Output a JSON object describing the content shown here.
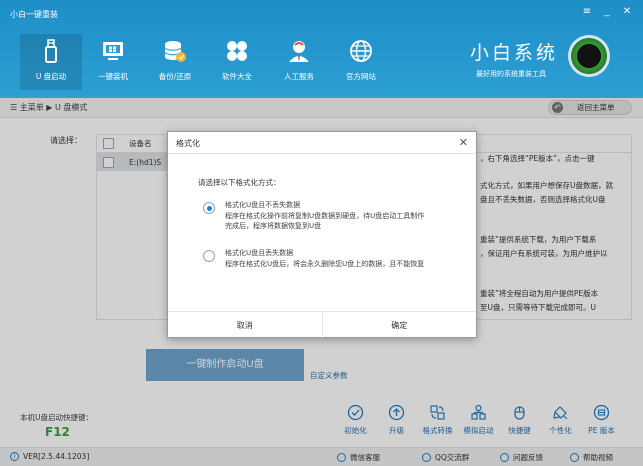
{
  "app": {
    "title": "小白一键重装",
    "window_controls": [
      "≡",
      "_",
      "✕"
    ],
    "brand_name": "小白系统",
    "brand_slogan": "最好用的系统重装工具"
  },
  "nav": {
    "items": [
      {
        "label": "U 盘启动",
        "icon": "usb-drive-icon",
        "active": true
      },
      {
        "label": "一键装机",
        "icon": "monitor-icon",
        "active": false
      },
      {
        "label": "备份/还原",
        "icon": "database-icon",
        "active": false
      },
      {
        "label": "软件大全",
        "icon": "apps-icon",
        "active": false
      },
      {
        "label": "人工服务",
        "icon": "person-service-icon",
        "active": false
      },
      {
        "label": "官方网站",
        "icon": "globe-icon",
        "active": false
      }
    ]
  },
  "breadcrumb": {
    "text": "☰ 主菜单 ▶ U 盘模式",
    "back_label": "返回主菜单"
  },
  "main": {
    "select_label": "请选择：",
    "table": {
      "headers": [
        "设备名"
      ],
      "rows": [
        [
          "E:(hd1)S"
        ]
      ]
    },
    "info_lines": [
      "，右下角选择“PE版本”，点击一键",
      "",
      "式化方式，如果用户想保存U盘数据，就",
      "盘且不丢失数据，否则选择格式化U盘",
      "",
      "",
      "重装”提供系统下载，为用户下载系",
      "，保证用户有系统可装，为用户维护以",
      "",
      "",
      "重装”将全程自动为用户提供PE版本",
      "至U盘，只需等待下载完成即可。U"
    ],
    "make_button": "一键制作启动U盘",
    "custom_params": "自定义参数",
    "hotkey_label": "本机U盘启动快捷键：",
    "hotkey_value": "F12"
  },
  "tools": [
    {
      "label": "初始化",
      "icon": "check-circle-icon"
    },
    {
      "label": "升级",
      "icon": "upgrade-icon"
    },
    {
      "label": "格式转换",
      "icon": "convert-icon"
    },
    {
      "label": "模拟启动",
      "icon": "simulate-icon"
    },
    {
      "label": "快捷键",
      "icon": "shortcut-icon"
    },
    {
      "label": "个性化",
      "icon": "personalize-icon"
    },
    {
      "label": "PE 版本",
      "icon": "pe-version-icon"
    }
  ],
  "status": {
    "version": "VER[2.5.44.1203]",
    "items": [
      "微信客服",
      "QQ交流群",
      "问题反馈",
      "帮助视频"
    ]
  },
  "dialog": {
    "title": "格式化",
    "prompt": "请选择以下格式化方式：",
    "options": [
      {
        "title": "格式化U盘且不丢失数据",
        "desc1": "程序在格式化操作前将复制U盘数据到硬盘，待U盘启动工具制作",
        "desc2": "完成后，程序将数据恢复到U盘",
        "selected": true
      },
      {
        "title": "格式化U盘且丢失数据",
        "desc1": "程序在格式化U盘后，将会永久删除您U盘上的数据，且不能恢复",
        "desc2": "",
        "selected": false
      }
    ],
    "cancel_label": "取消",
    "ok_label": "确定"
  },
  "colors": {
    "header": "#2c9fd4",
    "accent": "#2a7fc0",
    "hotkey": "#3aa03a",
    "make_button": "#6fa4cd"
  }
}
